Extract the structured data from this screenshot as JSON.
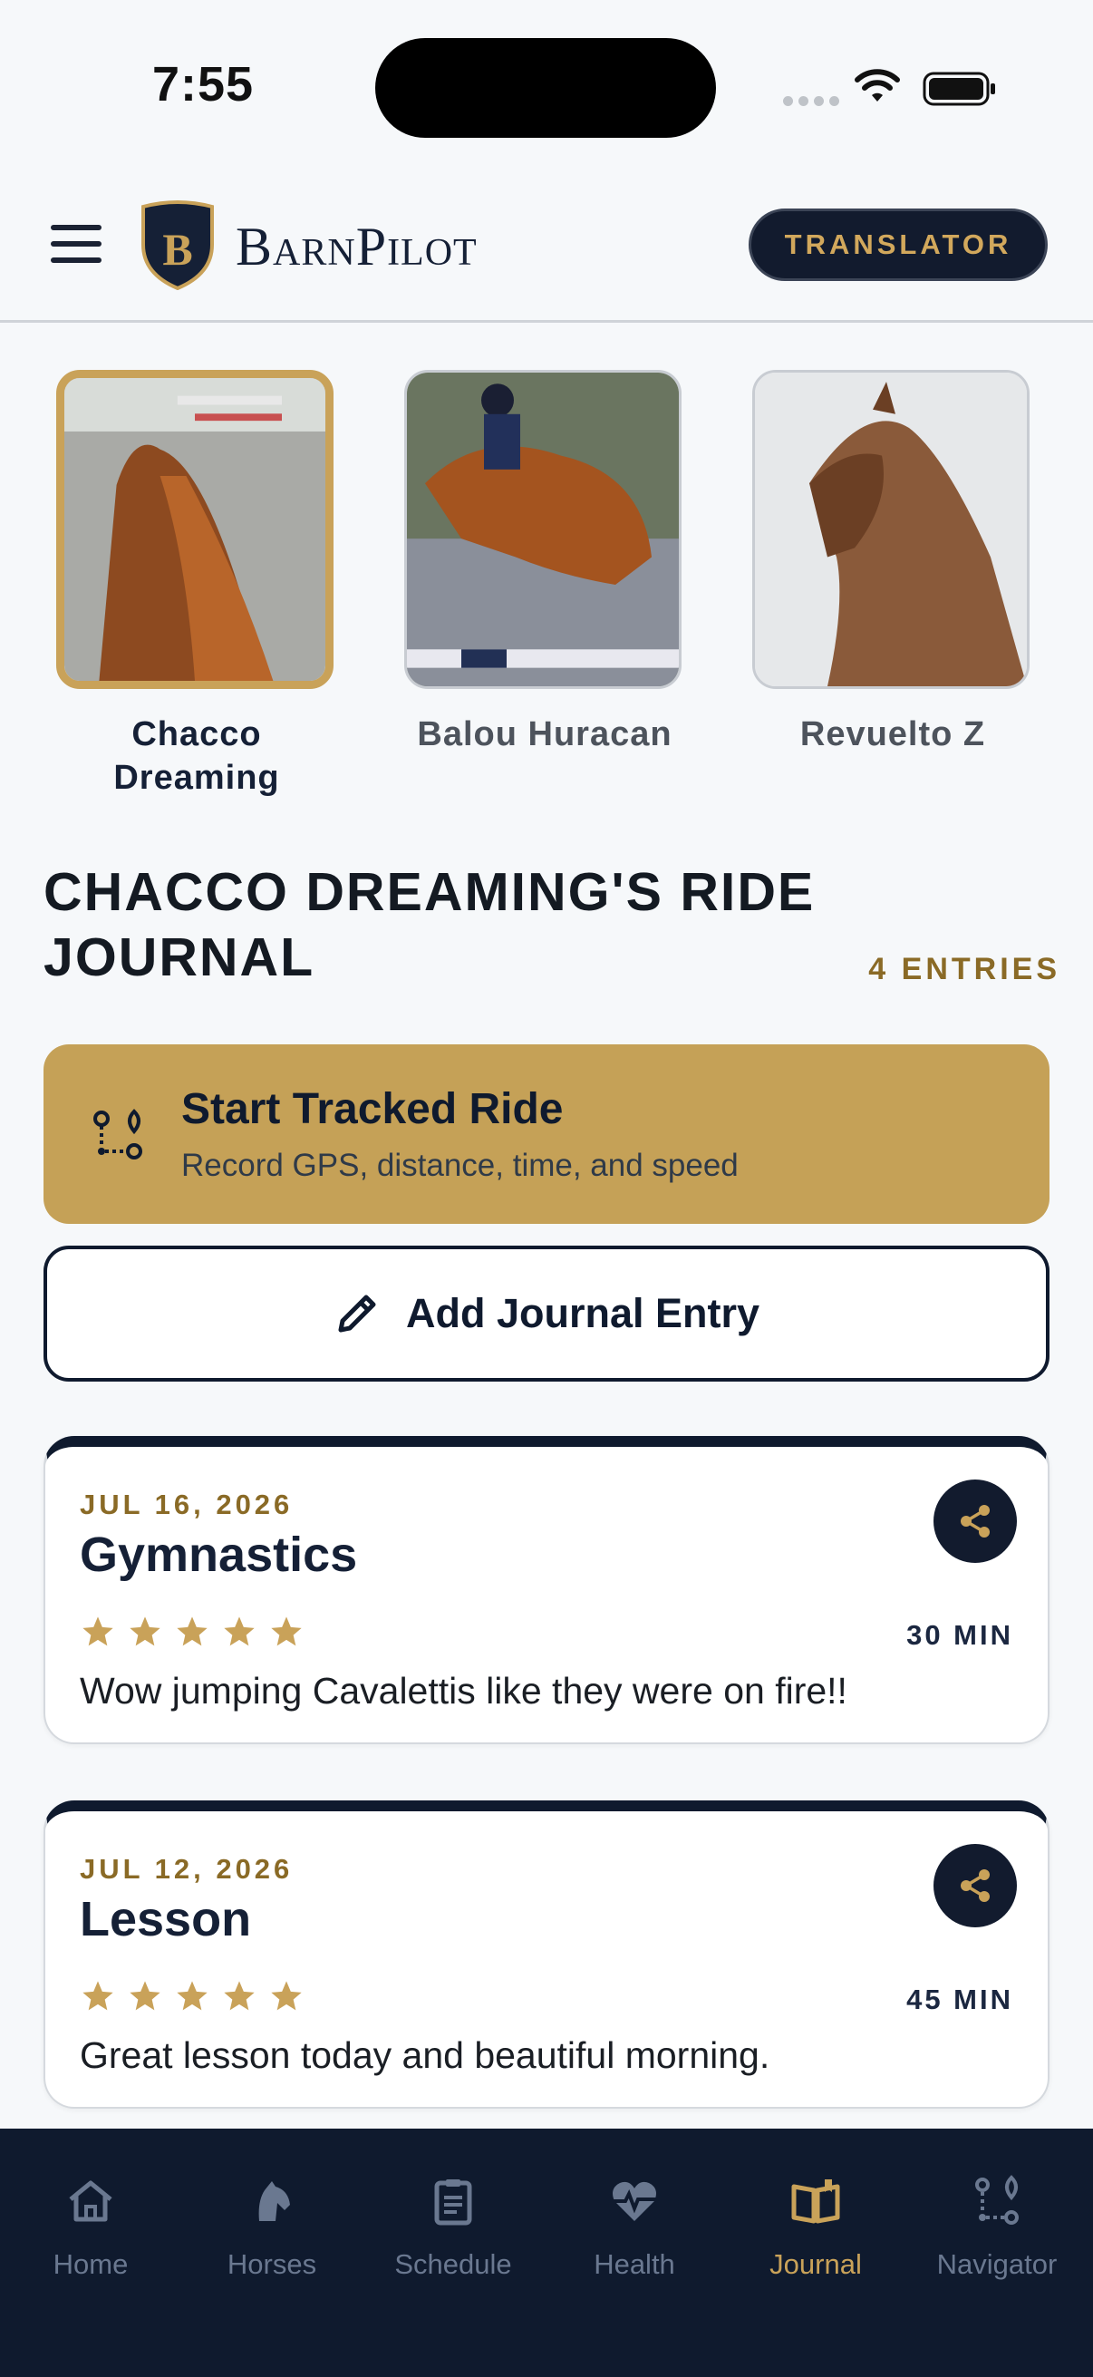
{
  "status_bar": {
    "time": "7:55"
  },
  "header": {
    "brand": "BarnPilot",
    "crest_letter": "B",
    "translator_label": "TRANSLATOR"
  },
  "horses": [
    {
      "name": "Chacco Dreaming",
      "selected": true
    },
    {
      "name": "Balou Huracan",
      "selected": false
    },
    {
      "name": "Revuelto Z",
      "selected": false
    }
  ],
  "journal": {
    "title": "CHACCO DREAMING'S RIDE JOURNAL",
    "entries_count": "4 ENTRIES"
  },
  "start_ride": {
    "title": "Start Tracked Ride",
    "subtitle": "Record GPS, distance, time, and speed"
  },
  "add_entry": {
    "label": "Add Journal Entry"
  },
  "entries": [
    {
      "date": "JUL 16, 2026",
      "title": "Gymnastics",
      "rating": 5,
      "duration": "30 MIN",
      "note": "Wow jumping Cavalettis like they were on fire!!"
    },
    {
      "date": "JUL 12, 2026",
      "title": "Lesson",
      "rating": 5,
      "duration": "45 MIN",
      "note": "Great lesson today and beautiful morning."
    }
  ],
  "nav": {
    "items": [
      {
        "label": "Home",
        "icon": "home-icon"
      },
      {
        "label": "Horses",
        "icon": "horse-head-icon"
      },
      {
        "label": "Schedule",
        "icon": "clipboard-icon"
      },
      {
        "label": "Health",
        "icon": "heart-pulse-icon"
      },
      {
        "label": "Journal",
        "icon": "book-open-icon",
        "active": true
      },
      {
        "label": "Navigator",
        "icon": "route-icon"
      }
    ]
  },
  "colors": {
    "navy": "#0f1a2e",
    "gold": "#c9a259",
    "accent_text": "#8a6a26",
    "background": "#f6f8fa"
  }
}
